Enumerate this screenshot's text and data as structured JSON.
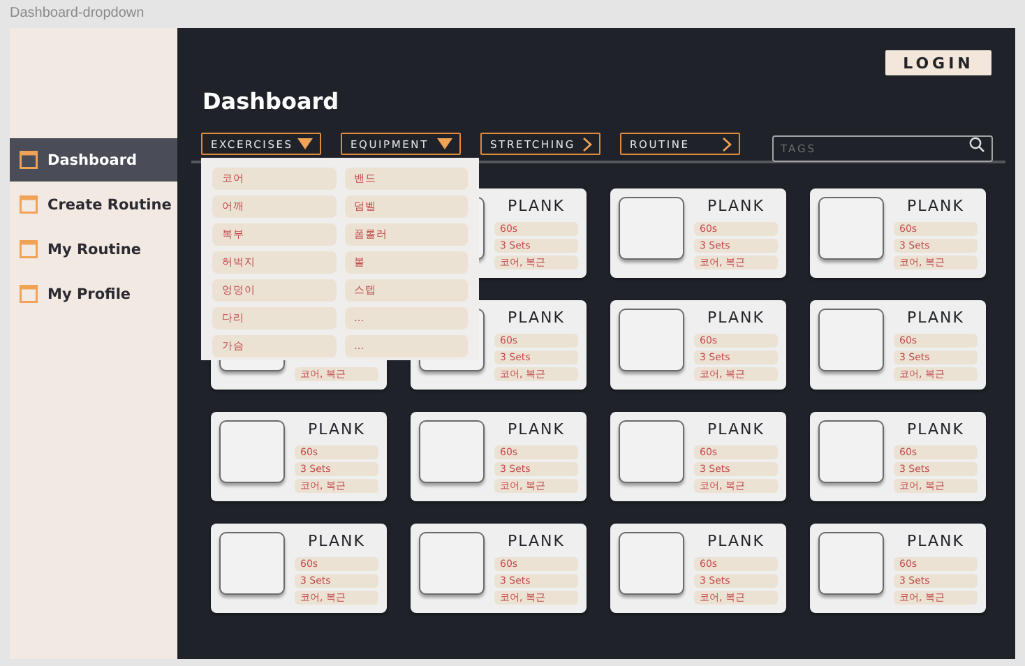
{
  "canvas_label": "Dashboard-dropdown",
  "sidebar": {
    "items": [
      {
        "label": "Dashboard",
        "selected": true
      },
      {
        "label": "Create Routine",
        "selected": false
      },
      {
        "label": "My Routine",
        "selected": false
      },
      {
        "label": "My Profile",
        "selected": false
      }
    ]
  },
  "login_button": "LOGIN",
  "title": "Dashboard",
  "filters": [
    {
      "label": "EXCERCISES",
      "kind": "dropdown"
    },
    {
      "label": "EQUIPMENT",
      "kind": "dropdown"
    },
    {
      "label": "STRETCHING",
      "kind": "link"
    },
    {
      "label": "ROUTINE",
      "kind": "link"
    }
  ],
  "search": {
    "placeholder": "TAGS"
  },
  "dropdown": {
    "columns": [
      [
        "코어",
        "어깨",
        "복부",
        "허벅지",
        "엉덩이",
        "다리",
        "가슴"
      ],
      [
        "밴드",
        "덤벨",
        "폼롤러",
        "볼",
        "스텝",
        "...",
        "..."
      ]
    ]
  },
  "cards": [
    {
      "title": "PLANK",
      "tags": [
        "60s",
        "3 Sets",
        "코어, 복근"
      ]
    },
    {
      "title": "PLANK",
      "tags": [
        "60s",
        "3 Sets",
        "코어, 복근"
      ]
    },
    {
      "title": "PLANK",
      "tags": [
        "60s",
        "3 Sets",
        "코어, 복근"
      ]
    },
    {
      "tags_partial": "코어, 복근"
    },
    {
      "title": "PLANK",
      "tags": [
        "60s",
        "3 Sets",
        "코어, 복근"
      ]
    },
    {
      "title": "PLANK",
      "tags": [
        "60s",
        "3 Sets",
        "코어, 복근"
      ]
    },
    {
      "title": "PLANK",
      "tags": [
        "60s",
        "3 Sets",
        "코어, 복근"
      ]
    },
    {
      "title": "PLANK",
      "tags": [
        "60s",
        "3 Sets",
        "코어, 복근"
      ]
    },
    {
      "title": "PLANK",
      "tags": [
        "60s",
        "3 Sets",
        "코어, 복근"
      ]
    },
    {
      "title": "PLANK",
      "tags": [
        "60s",
        "3 Sets",
        "코어, 복근"
      ]
    },
    {
      "title": "PLANK",
      "tags": [
        "60s",
        "3 Sets",
        "코어, 복근"
      ]
    },
    {
      "title": "PLANK",
      "tags": [
        "60s",
        "3 Sets",
        "코어, 복근"
      ]
    },
    {
      "title": "PLANK",
      "tags": [
        "60s",
        "3 Sets",
        "코어, 복근"
      ]
    },
    {
      "title": "PLANK",
      "tags": [
        "60s",
        "3 Sets",
        "코어, 복근"
      ]
    },
    {
      "title": "PLANK",
      "tags": [
        "60s",
        "3 Sets",
        "코어, 복근"
      ]
    }
  ]
}
